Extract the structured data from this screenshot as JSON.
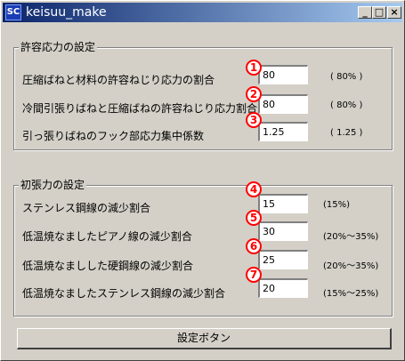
{
  "window": {
    "icon_text": "SC",
    "title": "keisuu_make",
    "minimize_label": "_",
    "maximize_label": "□",
    "close_label": "×"
  },
  "group1": {
    "title": "許容応力の設定",
    "rows": [
      {
        "marker": "1",
        "label": "圧縮ばねと材料の許容ねじり応力の割合",
        "value": "80",
        "hint": "( 80% )"
      },
      {
        "marker": "2",
        "label": "冷間引張りばねと圧縮ばねの許容ねじり応力割合",
        "value": "80",
        "hint": "( 80% )"
      },
      {
        "marker": "3",
        "label": "引っ張りばねのフック部応力集中係数",
        "value": "1.25",
        "hint": "( 1.25 )"
      }
    ]
  },
  "group2": {
    "title": "初張力の設定",
    "rows": [
      {
        "marker": "4",
        "label": "ステンレス鋼線の減少割合",
        "value": "15",
        "hint": "(15%)"
      },
      {
        "marker": "5",
        "label": "低温焼なましたピアノ線の減少割合",
        "value": "30",
        "hint": "(20%～35%)"
      },
      {
        "marker": "6",
        "label": "低温焼なましした硬鋼線の減少割合",
        "value": "25",
        "hint": "(20%～35%)"
      },
      {
        "marker": "7",
        "label": "低温焼なましたステンレス鋼線の減少割合",
        "value": "20",
        "hint": "(15%～25%)"
      }
    ]
  },
  "buttons": {
    "set_label": "設定ボタン"
  }
}
